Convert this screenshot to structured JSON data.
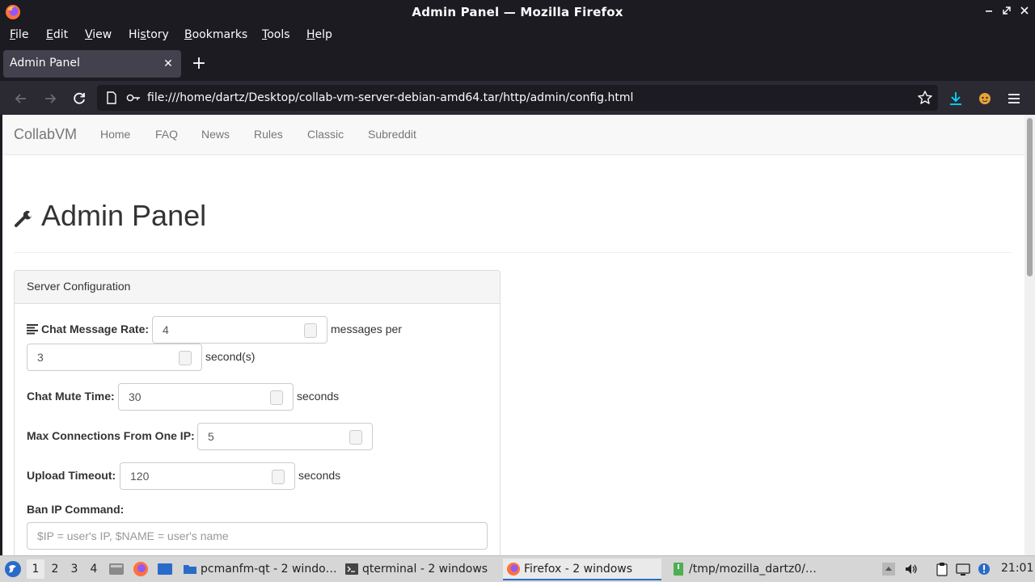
{
  "window": {
    "title": "Admin Panel — Mozilla Firefox"
  },
  "menubar": {
    "items": [
      {
        "prefix": "",
        "ul": "F",
        "rest": "ile"
      },
      {
        "prefix": "",
        "ul": "E",
        "rest": "dit"
      },
      {
        "prefix": "",
        "ul": "V",
        "rest": "iew"
      },
      {
        "prefix": "Hi",
        "ul": "s",
        "rest": "tory"
      },
      {
        "prefix": "",
        "ul": "B",
        "rest": "ookmarks"
      },
      {
        "prefix": "",
        "ul": "T",
        "rest": "ools"
      },
      {
        "prefix": "",
        "ul": "H",
        "rest": "elp"
      }
    ]
  },
  "tabs": {
    "active_title": "Admin Panel",
    "close_glyph": "✕",
    "new_tab_glyph": "+"
  },
  "navbar": {
    "url": "file:///home/dartz/Desktop/collab-vm-server-debian-amd64.tar/http/admin/config.html"
  },
  "site": {
    "brand": "CollabVM",
    "links": [
      "Home",
      "FAQ",
      "News",
      "Rules",
      "Classic",
      "Subreddit"
    ]
  },
  "page": {
    "heading": "Admin Panel",
    "panel_title": "Server Configuration",
    "chat_rate": {
      "label": "Chat Message Rate:",
      "messages": "4",
      "messages_suffix": "messages per",
      "seconds": "3",
      "seconds_suffix": "second(s)"
    },
    "mute_time": {
      "label": "Chat Mute Time:",
      "value": "30",
      "suffix": "seconds"
    },
    "max_connections": {
      "label": "Max Connections From One IP:",
      "value": "5"
    },
    "upload_timeout": {
      "label": "Upload Timeout:",
      "value": "120",
      "suffix": "seconds"
    },
    "ban_command": {
      "label": "Ban IP Command:",
      "placeholder": "$IP = user's IP, $NAME = user's name"
    }
  },
  "taskbar": {
    "workspaces": [
      "1",
      "2",
      "3",
      "4"
    ],
    "active_workspace": "1",
    "tasks": [
      {
        "label": "pcmanfm-qt - 2 windo…",
        "icon": "folder-icon"
      },
      {
        "label": "qterminal - 2 windows",
        "icon": "terminal-icon"
      },
      {
        "label": "Firefox - 2 windows",
        "icon": "firefox-icon"
      },
      {
        "label": "/tmp/mozilla_dartz0/…",
        "icon": "archive-icon"
      }
    ],
    "clock": "21:01"
  },
  "colors": {
    "chrome_dark": "#1c1b22",
    "toolbar": "#2b2a33",
    "tab_active": "#42414d",
    "download_accent": "#00ddff",
    "link_gray": "#777777",
    "taskbar": "#d6d6d6"
  }
}
